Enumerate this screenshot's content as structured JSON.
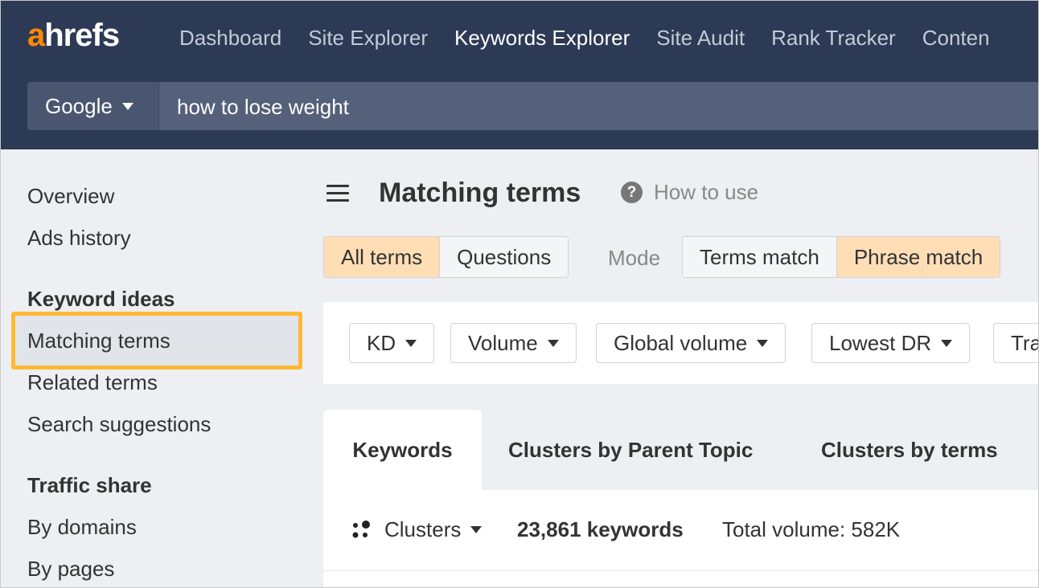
{
  "header": {
    "logo": {
      "accent": "a",
      "rest": "hrefs"
    },
    "nav": [
      "Dashboard",
      "Site Explorer",
      "Keywords Explorer",
      "Site Audit",
      "Rank Tracker",
      "Conten"
    ],
    "active_nav": "Keywords Explorer"
  },
  "search": {
    "engine": "Google",
    "query": "how to lose weight"
  },
  "sidebar": {
    "items_top": [
      "Overview",
      "Ads history"
    ],
    "section_keyword_ideas": "Keyword ideas",
    "keyword_ideas": [
      "Matching terms",
      "Related terms",
      "Search suggestions"
    ],
    "selected": "Matching terms",
    "section_traffic_share": "Traffic share",
    "traffic_share": [
      "By domains",
      "By pages"
    ]
  },
  "main": {
    "title": "Matching terms",
    "how_to_use": "How to use",
    "term_toggle": [
      "All terms",
      "Questions"
    ],
    "mode_label": "Mode",
    "match_toggle": [
      "Terms match",
      "Phrase match"
    ],
    "filters": [
      "KD",
      "Volume",
      "Global volume",
      "Lowest DR",
      "Tra"
    ],
    "tabs": [
      "Keywords",
      "Clusters by Parent Topic",
      "Clusters by terms"
    ],
    "clusters_label": "Clusters",
    "keyword_count": "23,861 keywords",
    "total_volume": "Total volume: 582K"
  },
  "colors": {
    "header_bg": "#2d3a55",
    "brand_orange": "#ff8800",
    "highlight_border": "#ffb833",
    "toggle_active": "#ffdeb6"
  }
}
